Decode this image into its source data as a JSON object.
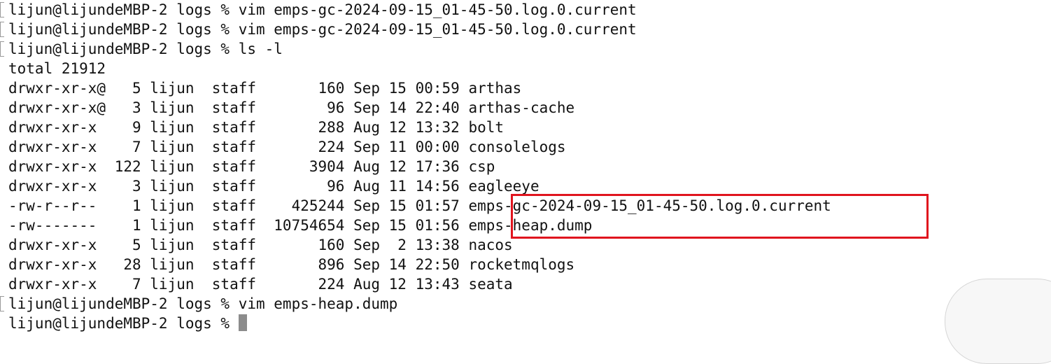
{
  "terminal": {
    "lines": [
      {
        "type": "prompt",
        "text": "lijun@lijundeMBP-2 logs % vim emps-gc-2024-09-15_01-45-50.log.0.current"
      },
      {
        "type": "prompt",
        "text": "lijun@lijundeMBP-2 logs % vim emps-gc-2024-09-15_01-45-50.log.0.current"
      },
      {
        "type": "prompt",
        "text": "lijun@lijundeMBP-2 logs % ls -l"
      },
      {
        "type": "output",
        "text": "total 21912"
      },
      {
        "type": "output",
        "text": "drwxr-xr-x@   5 lijun  staff       160 Sep 15 00:59 arthas"
      },
      {
        "type": "output",
        "text": "drwxr-xr-x@   3 lijun  staff        96 Sep 14 22:40 arthas-cache"
      },
      {
        "type": "output",
        "text": "drwxr-xr-x    9 lijun  staff       288 Aug 12 13:32 bolt"
      },
      {
        "type": "output",
        "text": "drwxr-xr-x    7 lijun  staff       224 Sep 11 00:00 consolelogs"
      },
      {
        "type": "output",
        "text": "drwxr-xr-x  122 lijun  staff      3904 Aug 12 17:36 csp"
      },
      {
        "type": "output",
        "text": "drwxr-xr-x    3 lijun  staff        96 Aug 11 14:56 eagleeye"
      },
      {
        "type": "output",
        "text": "-rw-r--r--    1 lijun  staff    425244 Sep 15 01:57 emps-gc-2024-09-15_01-45-50.log.0.current"
      },
      {
        "type": "output",
        "text": "-rw-------    1 lijun  staff  10754654 Sep 15 01:56 emps-heap.dump"
      },
      {
        "type": "output",
        "text": "drwxr-xr-x    5 lijun  staff       160 Sep  2 13:38 nacos"
      },
      {
        "type": "output",
        "text": "drwxr-xr-x   28 lijun  staff       896 Sep 14 22:50 rocketmqlogs"
      },
      {
        "type": "output",
        "text": "drwxr-xr-x    7 lijun  staff       224 Aug 12 13:43 seata"
      },
      {
        "type": "prompt",
        "text": "lijun@lijundeMBP-2 logs % vim emps-heap.dump"
      }
    ],
    "current_prompt": "lijun@lijundeMBP-2 logs % "
  },
  "colors": {
    "background": "#ffffff",
    "text": "#111111",
    "highlight_border": "#e0141e",
    "cursor": "#8c8c8c"
  }
}
